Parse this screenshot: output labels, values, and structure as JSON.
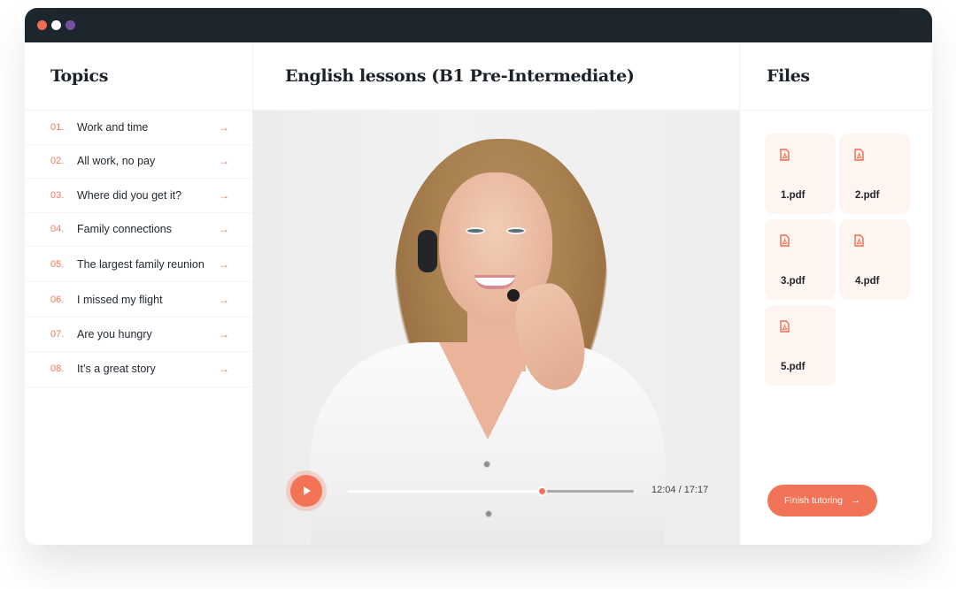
{
  "window": {
    "controls": [
      {
        "name": "close",
        "color": "#ef6c50"
      },
      {
        "name": "minimize",
        "color": "#ffffff"
      },
      {
        "name": "maximize",
        "color": "#7a4fa0"
      }
    ]
  },
  "topics": {
    "title": "Topics",
    "items": [
      {
        "number": "01.",
        "label": "Work and time",
        "arrow": "→"
      },
      {
        "number": "02.",
        "label": "All work, no pay",
        "arrow": "→"
      },
      {
        "number": "03.",
        "label": "Where did you get it?",
        "arrow": "→"
      },
      {
        "number": "04.",
        "label": "Family connections",
        "arrow": "→"
      },
      {
        "number": "05.",
        "label": "The largest family reunion",
        "arrow": "→"
      },
      {
        "number": "06.",
        "label": "I missed my flight",
        "arrow": "→"
      },
      {
        "number": "07.",
        "label": "Are you hungry",
        "arrow": "→"
      },
      {
        "number": "08.",
        "label": "It’s a great story",
        "arrow": "→"
      }
    ]
  },
  "main": {
    "title": "English lessons (B1 Pre-Intermediate)",
    "video": {
      "subject": "Smiling woman with headset and microphone",
      "play_icon": "play-icon",
      "current_time": "12:04",
      "duration": "17:17",
      "time_label": "12:04 / 17:17",
      "progress": 0.68
    }
  },
  "files": {
    "title": "Files",
    "items": [
      {
        "name": "1.pdf",
        "icon": "pdf-file-icon"
      },
      {
        "name": "2.pdf",
        "icon": "pdf-file-icon"
      },
      {
        "name": "3.pdf",
        "icon": "pdf-file-icon"
      },
      {
        "name": "4.pdf",
        "icon": "pdf-file-icon"
      },
      {
        "name": "5.pdf",
        "icon": "pdf-file-icon"
      }
    ],
    "finish_button": {
      "label": "Finish tutoring",
      "arrow": "→"
    }
  },
  "colors": {
    "accent": "#f27356",
    "titlebar": "#1e262d",
    "file_card_bg": "#fef4f0",
    "text_dark": "#1c232b"
  }
}
